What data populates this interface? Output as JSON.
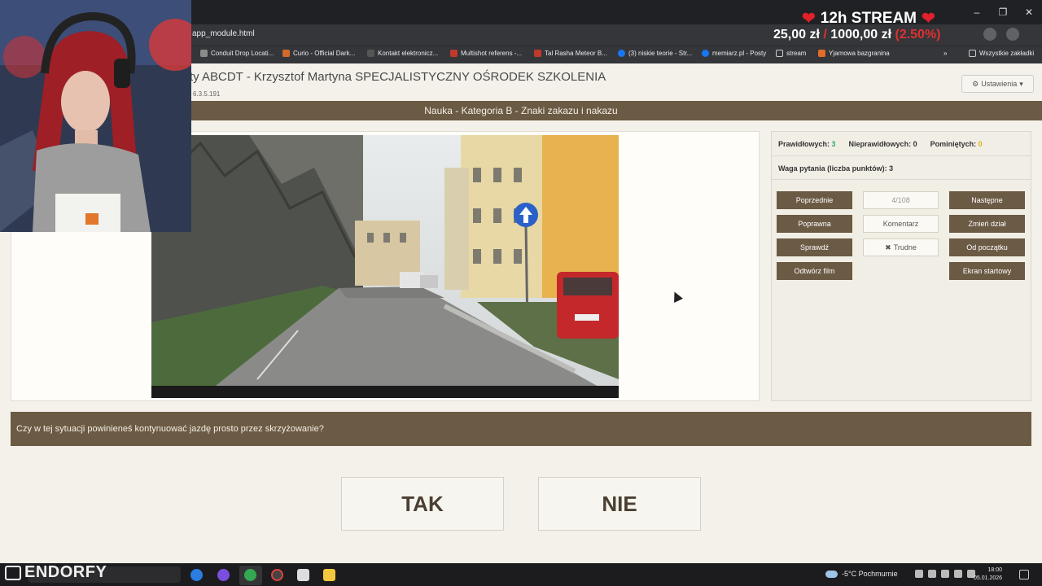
{
  "browser": {
    "url": "app_module.html",
    "window_controls": [
      "–",
      "❐",
      "✕"
    ],
    "bookmarks": [
      {
        "label": "Conduit Drop Locati...",
        "color": "#8a8a8a"
      },
      {
        "label": "Curio - Official Dark...",
        "color": "#d06a2a"
      },
      {
        "label": "Kontakt elektronicz...",
        "color": "#555555"
      },
      {
        "label": "Multishot referens -...",
        "color": "#c0392b"
      },
      {
        "label": "Tal Rasha Meteor B...",
        "color": "#c0392b"
      },
      {
        "label": "(3) niskie teorie - Str...",
        "color": "#1877f2"
      },
      {
        "label": "memiarz.pl - Posty",
        "color": "#1877f2"
      },
      {
        "label": "stream",
        "color": "#888888"
      },
      {
        "label": "Yjamowa bazgranina",
        "color": "#e56b2a"
      }
    ],
    "all_bookmarks": "Wszystkie zakładki"
  },
  "header": {
    "title": "ty ABCDT - Krzysztof Martyna SPECJALISTYCZNY OŚRODEK SZKOLENIA",
    "version": "6.3.5.191",
    "settings_label": "Ustawienia"
  },
  "section_title": "Nauka - Kategoria B - Znaki zakazu i nakazu",
  "stats": {
    "correct_label": "Prawidłowych:",
    "correct_value": "3",
    "incorrect_label": "Nieprawidłowych:",
    "incorrect_value": "0",
    "skipped_label": "Pominiętych:",
    "skipped_value": "0",
    "weight": "Waga pytania (liczba punktów): 3"
  },
  "controls": {
    "previous": "Poprzednie",
    "counter": "4/108",
    "next": "Następne",
    "correct": "Poprawna",
    "comment": "Komentarz",
    "change_section": "Zmień dział",
    "check": "Sprawdź",
    "difficult": "Trudne",
    "from_start": "Od początku",
    "play_video": "Odtwórz film",
    "start_screen": "Ekran startowy"
  },
  "question": "Czy w tej sytuacji powinieneś kontynuować jazdę prosto przez skrzyżowanie?",
  "answers": {
    "yes": "TAK",
    "no": "NIE"
  },
  "stream": {
    "title": "12h STREAM",
    "current": "25,00 zł",
    "separator": "/",
    "goal": "1000,00 zł",
    "percent": "(2.50%)"
  },
  "taskbar": {
    "brand": "ENDORFY",
    "weather": "-5°C Pochmurnie",
    "time": "18:00",
    "date": "05.01.2026"
  }
}
